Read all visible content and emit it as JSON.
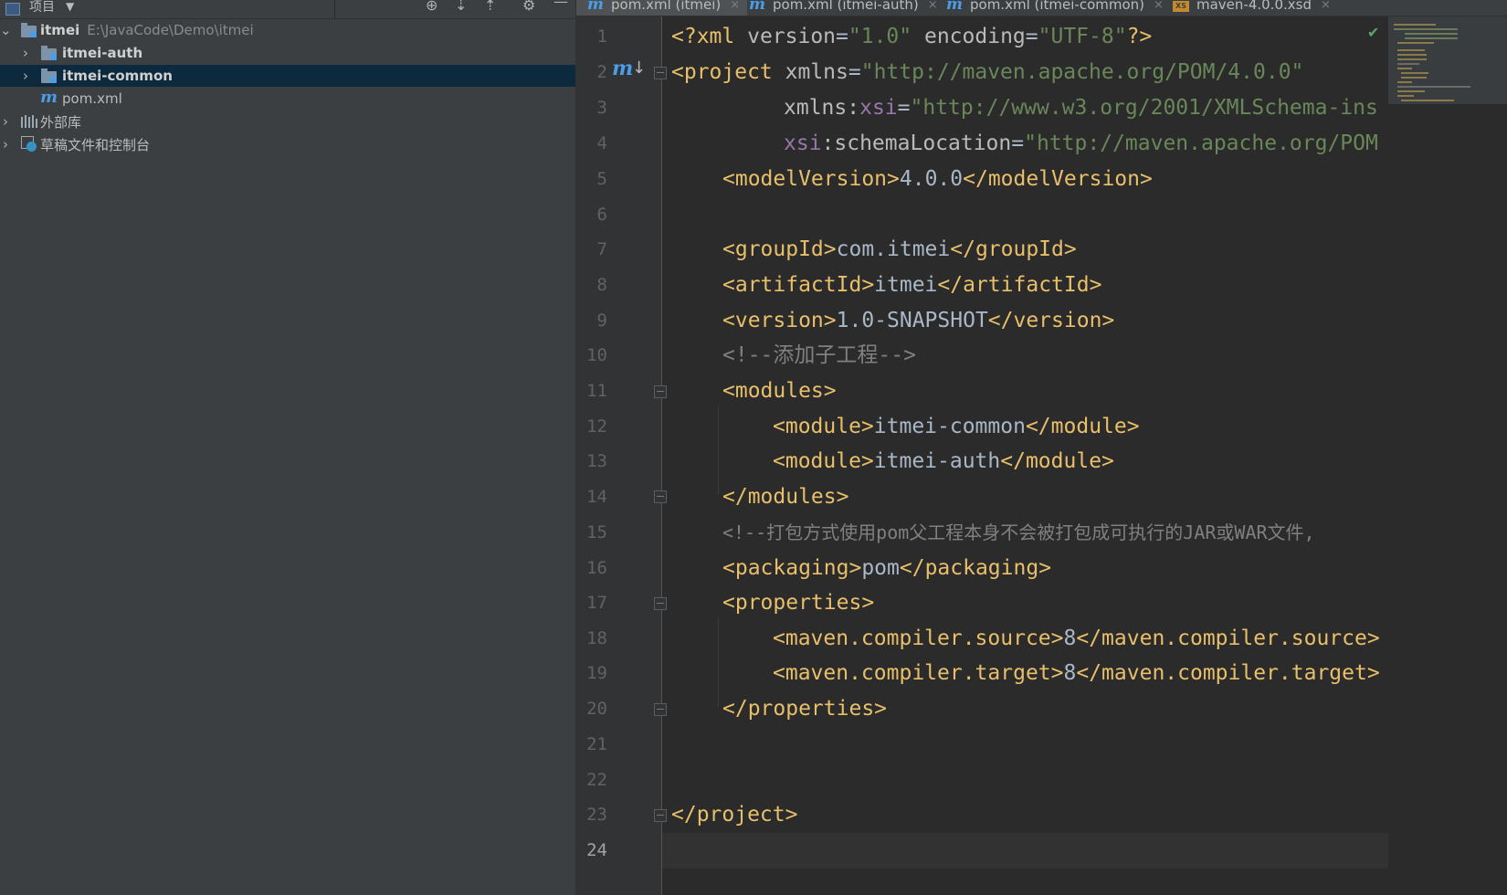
{
  "project_panel": {
    "title": "项目",
    "tree": [
      {
        "label": "itmei",
        "path": "E:\\JavaCode\\Demo\\itmei",
        "expanded": true
      },
      {
        "label": "itmei-auth",
        "expanded": false
      },
      {
        "label": "itmei-common",
        "expanded": false,
        "selected": true
      },
      {
        "label": "pom.xml"
      },
      {
        "label": "外部库",
        "expanded": false
      },
      {
        "label": "草稿文件和控制台",
        "expanded": false
      }
    ]
  },
  "tabs": [
    {
      "label": "pom.xml (itmei)",
      "active": true
    },
    {
      "label": "pom.xml (itmei-auth)"
    },
    {
      "label": "pom.xml (itmei-common)"
    },
    {
      "label": "maven-4.0.0.xsd"
    }
  ],
  "editor": {
    "line_numbers": [
      "1",
      "2",
      "3",
      "4",
      "5",
      "6",
      "7",
      "8",
      "9",
      "10",
      "11",
      "12",
      "13",
      "14",
      "15",
      "16",
      "17",
      "18",
      "19",
      "20",
      "21",
      "22",
      "23",
      "24"
    ],
    "current_line": "24",
    "code": {
      "l1": {
        "decl_open": "<?xml ",
        "version_attr": "version",
        "eq1": "=",
        "version_val": "\"1.0\"",
        "encoding_attr": " encoding",
        "eq2": "=",
        "encoding_val": "\"UTF-8\"",
        "decl_close": "?>"
      },
      "l2": {
        "tag_open": "<project ",
        "xmlns_attr": "xmlns",
        "eq": "=",
        "xmlns_val": "\"http://maven.apache.org/POM/4.0.0\""
      },
      "l3": {
        "prefix": "xmlns:",
        "ns": "xsi",
        "eq": "=",
        "val": "\"http://www.w3.org/2001/XMLSchema-ins"
      },
      "l4": {
        "ns": "xsi",
        "attr": ":schemaLocation",
        "eq": "=",
        "val": "\"http://maven.apache.org/POM"
      },
      "l5": {
        "open": "<modelVersion>",
        "text": "4.0.0",
        "close": "</modelVersion>"
      },
      "l7": {
        "open": "<groupId>",
        "text": "com.itmei",
        "close": "</groupId>"
      },
      "l8": {
        "open": "<artifactId>",
        "text": "itmei",
        "close": "</artifactId>"
      },
      "l9": {
        "open": "<version>",
        "text": "1.0-SNAPSHOT",
        "close": "</version>"
      },
      "l10": {
        "comment": "<!--添加子工程-->"
      },
      "l11": {
        "open": "<modules>"
      },
      "l12": {
        "open": "<module>",
        "text": "itmei-common",
        "close": "</module>"
      },
      "l13": {
        "open": "<module>",
        "text": "itmei-auth",
        "close": "</module>"
      },
      "l14": {
        "close": "</modules>"
      },
      "l15": {
        "comment": "<!--打包方式使用pom父工程本身不会被打包成可执行的JAR或WAR文件,"
      },
      "l16": {
        "open": "<packaging>",
        "text": "pom",
        "close": "</packaging>"
      },
      "l17": {
        "open": "<properties>"
      },
      "l18": {
        "open": "<maven.compiler.source>",
        "text": "8",
        "close": "</maven.compiler.source>"
      },
      "l19": {
        "open": "<maven.compiler.target>",
        "text": "8",
        "close": "</maven.compiler.target>"
      },
      "l20": {
        "close": "</properties>"
      },
      "l23": {
        "close": "</project>"
      }
    }
  },
  "icons": {
    "gutter_maven": "m",
    "checkmark": "✔",
    "close_tab": "×",
    "xsd_badge": "XS"
  },
  "colors": {
    "tag": "#e8bf6a",
    "string": "#6a8759",
    "namespace": "#9876aa",
    "comment": "#808080",
    "selection": "#0d293e",
    "maven_blue": "#4a9de6"
  }
}
